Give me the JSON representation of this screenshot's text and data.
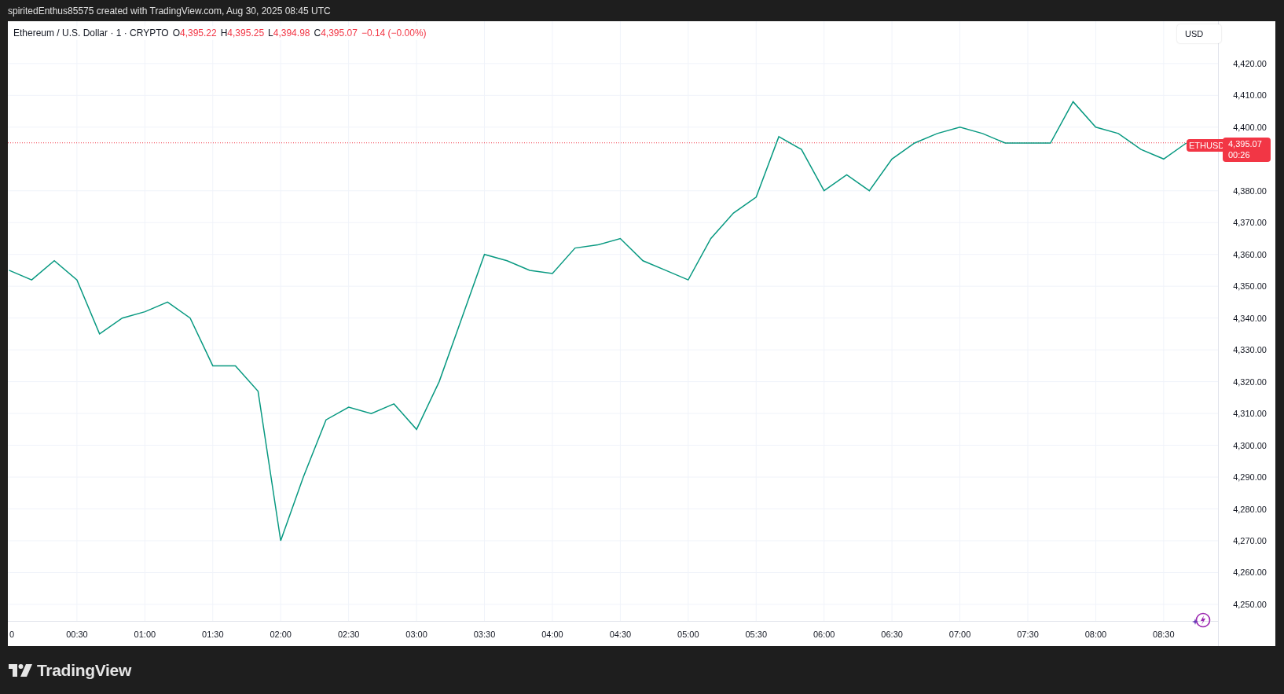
{
  "caption": "spiritedEnthus85575 created with TradingView.com, Aug 30, 2025 08:45 UTC",
  "legend": {
    "symbol": "Ethereum / U.S. Dollar · 1 · CRYPTO",
    "ohlc": [
      {
        "label": "O",
        "value": "4,395.22"
      },
      {
        "label": "H",
        "value": "4,395.25"
      },
      {
        "label": "L",
        "value": "4,394.98"
      },
      {
        "label": "C",
        "value": "4,395.07"
      }
    ],
    "change": "−0.14 (−0.00%)"
  },
  "currency_button": "USD",
  "price_tag": {
    "countdown": "00:26"
  },
  "chart_data": {
    "type": "line",
    "grid": true,
    "xlim": [
      0,
      534
    ],
    "ylim": [
      4244.8,
      4433.3
    ],
    "x": [
      0,
      10,
      20,
      30,
      40,
      50,
      60,
      70,
      80,
      90,
      100,
      110,
      120,
      130,
      140,
      150,
      160,
      170,
      180,
      190,
      200,
      210,
      220,
      230,
      240,
      250,
      260,
      270,
      280,
      290,
      300,
      310,
      320,
      330,
      340,
      350,
      360,
      370,
      380,
      390,
      400,
      410,
      420,
      430,
      440,
      450,
      460,
      470,
      480,
      490,
      500,
      510,
      520
    ],
    "series": [
      {
        "name": "ETHUSD",
        "color": "#089981",
        "values": [
          4355,
          4352,
          4358,
          4352,
          4335,
          4340,
          4342,
          4345,
          4340,
          4325,
          4325,
          4317,
          4270,
          4290,
          4308,
          4312,
          4310,
          4313,
          4305,
          4320,
          4340,
          4360,
          4358,
          4355,
          4354,
          4362,
          4363,
          4365,
          4358,
          4355,
          4352,
          4365,
          4373,
          4378,
          4397,
          4393,
          4380,
          4385,
          4380,
          4390,
          4395,
          4398,
          4400,
          4398,
          4395,
          4395,
          4395,
          4408,
          4400,
          4398,
          4393,
          4390,
          4395
        ]
      }
    ],
    "xticks": [
      {
        "value": 0,
        "label": "0"
      },
      {
        "value": 30,
        "label": "00:30"
      },
      {
        "value": 60,
        "label": "01:00"
      },
      {
        "value": 90,
        "label": "01:30"
      },
      {
        "value": 120,
        "label": "02:00"
      },
      {
        "value": 150,
        "label": "02:30"
      },
      {
        "value": 180,
        "label": "03:00"
      },
      {
        "value": 210,
        "label": "03:30"
      },
      {
        "value": 240,
        "label": "04:00"
      },
      {
        "value": 270,
        "label": "04:30"
      },
      {
        "value": 300,
        "label": "05:00"
      },
      {
        "value": 330,
        "label": "05:30"
      },
      {
        "value": 360,
        "label": "06:00"
      },
      {
        "value": 390,
        "label": "06:30"
      },
      {
        "value": 420,
        "label": "07:00"
      },
      {
        "value": 450,
        "label": "07:30"
      },
      {
        "value": 480,
        "label": "08:00"
      },
      {
        "value": 510,
        "label": "08:30"
      }
    ],
    "yticks": [
      {
        "value": 4420,
        "label": "4,420.00"
      },
      {
        "value": 4410,
        "label": "4,410.00"
      },
      {
        "value": 4400,
        "label": "4,400.00"
      },
      {
        "value": 4380,
        "label": "4,380.00"
      },
      {
        "value": 4370,
        "label": "4,370.00"
      },
      {
        "value": 4360,
        "label": "4,360.00"
      },
      {
        "value": 4350,
        "label": "4,350.00"
      },
      {
        "value": 4340,
        "label": "4,340.00"
      },
      {
        "value": 4330,
        "label": "4,330.00"
      },
      {
        "value": 4320,
        "label": "4,320.00"
      },
      {
        "value": 4310,
        "label": "4,310.00"
      },
      {
        "value": 4300,
        "label": "4,300.00"
      },
      {
        "value": 4290,
        "label": "4,290.00"
      },
      {
        "value": 4280,
        "label": "4,280.00"
      },
      {
        "value": 4270,
        "label": "4,270.00"
      },
      {
        "value": 4260,
        "label": "4,260.00"
      },
      {
        "value": 4250,
        "label": "4,250.00"
      }
    ],
    "ref_lines": [
      {
        "axis": "y",
        "value": 4395.07,
        "color": "#f23645",
        "label": "4,395.07"
      }
    ]
  },
  "brand": "TradingView"
}
